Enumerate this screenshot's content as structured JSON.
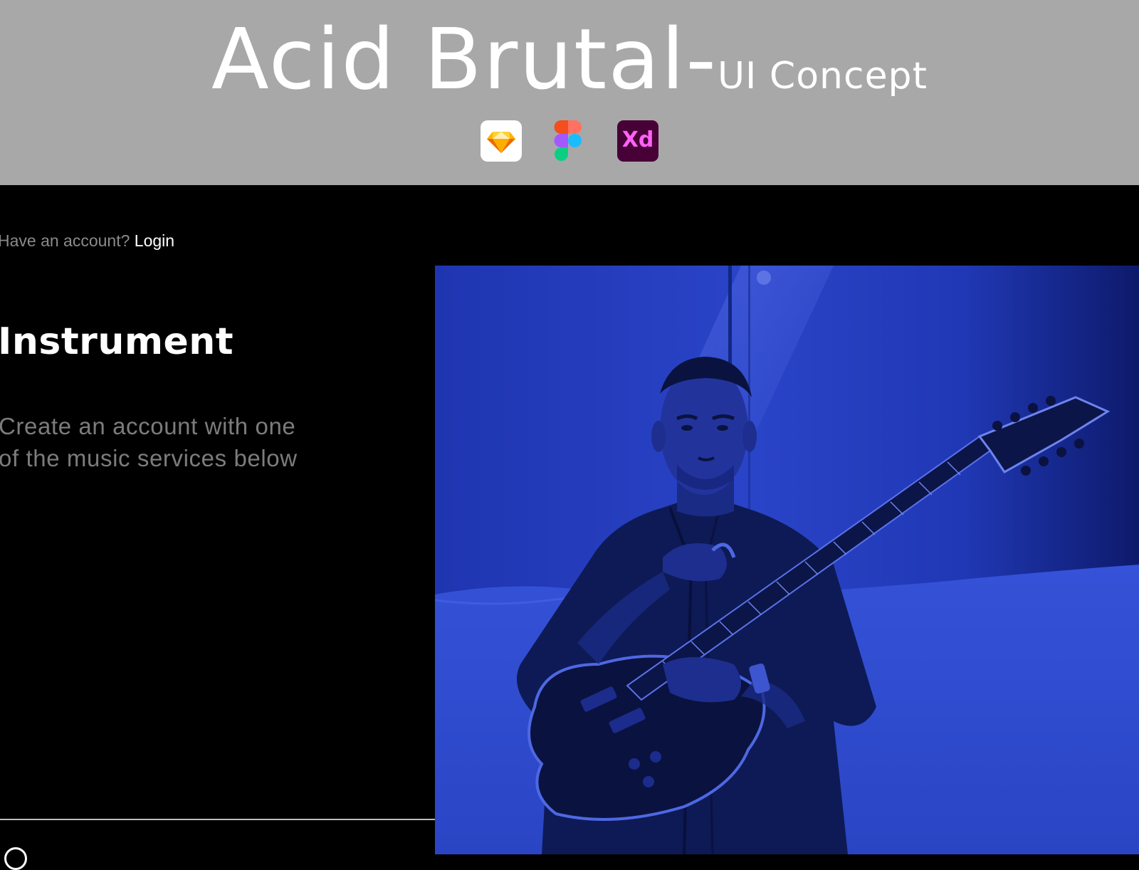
{
  "banner": {
    "title_main": "Acid Brutal-",
    "title_sub": "UI Concept",
    "tools": [
      {
        "name": "sketch-icon"
      },
      {
        "name": "figma-icon"
      },
      {
        "name": "xd-icon",
        "label": "Xd"
      }
    ]
  },
  "header": {
    "account_question": "Have an account?",
    "login_label": "Login"
  },
  "brand": {
    "name": "Instrument"
  },
  "intro": {
    "text": "Create an account with one of the music services below"
  },
  "hero": {
    "image": "guitarist-photo",
    "tint_color": "#2440c4"
  },
  "colors": {
    "banner_bg": "#a8a8a8",
    "app_bg": "#000000",
    "muted_text": "#7c7c7c",
    "accent_blue": "#2440c4"
  }
}
